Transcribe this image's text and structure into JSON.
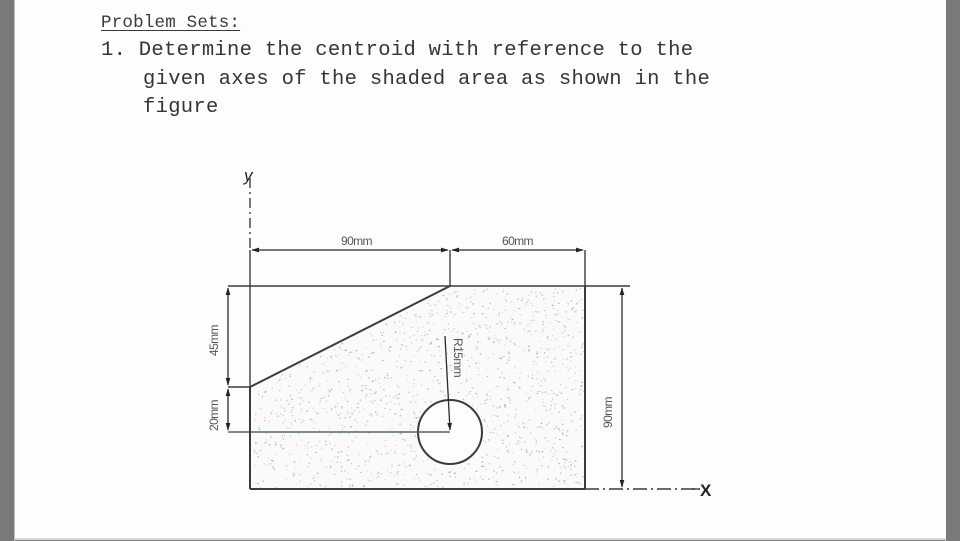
{
  "document": {
    "heading": "Problem Sets:",
    "problem": {
      "number": "1.",
      "lines": [
        "1. Determine the centroid with reference to the",
        "given axes of the shaded area as shown in the",
        "figure"
      ]
    }
  },
  "figure": {
    "y_axis_label": "y",
    "x_axis_label": "X",
    "dimensions": {
      "top_left_width": "90mm",
      "top_right_width": "60mm",
      "left_upper_height": "45mm",
      "left_lower_height": "20mm",
      "right_total_height": "90mm",
      "hole_radius": "R15mm"
    },
    "colors": {
      "line": "#3c3c3c",
      "shading_dots": "#9a9a9a",
      "dim_text": "#555555"
    }
  }
}
